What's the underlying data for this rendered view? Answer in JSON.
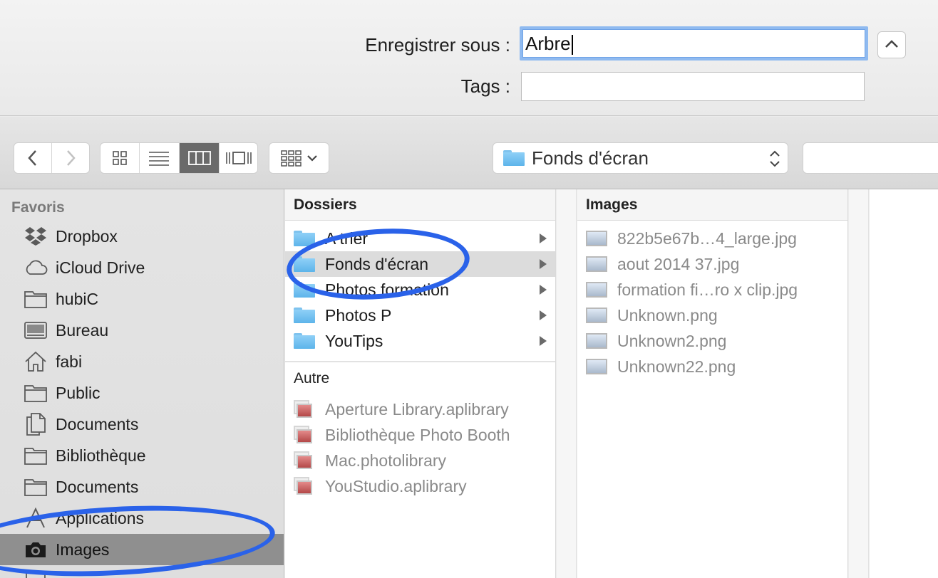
{
  "save_panel": {
    "save_as_label": "Enregistrer sous :",
    "save_as_value": "Arbre",
    "tags_label": "Tags :",
    "tags_value": ""
  },
  "toolbar": {
    "view_buttons": [
      "icon-view",
      "list-view",
      "column-view",
      "cover-flow-view"
    ],
    "active_view": "column-view",
    "path_popup_label": "Fonds d'écran"
  },
  "sidebar": {
    "heading": "Favoris",
    "items": [
      {
        "label": "Dropbox",
        "icon": "dropbox-icon"
      },
      {
        "label": "iCloud Drive",
        "icon": "cloud-icon"
      },
      {
        "label": "hubiC",
        "icon": "folder-icon"
      },
      {
        "label": "Bureau",
        "icon": "desktop-icon"
      },
      {
        "label": "fabi",
        "icon": "home-icon"
      },
      {
        "label": "Public",
        "icon": "folder-icon"
      },
      {
        "label": "Documents",
        "icon": "documents-icon"
      },
      {
        "label": "Bibliothèque",
        "icon": "folder-icon"
      },
      {
        "label": "Documents",
        "icon": "folder-icon"
      },
      {
        "label": "Applications",
        "icon": "applications-icon"
      },
      {
        "label": "Images",
        "icon": "camera-icon",
        "selected": true
      }
    ]
  },
  "column1": {
    "heading": "Dossiers",
    "folders": [
      {
        "label": "A trier"
      },
      {
        "label": "Fonds d'écran",
        "selected": true
      },
      {
        "label": "Photos formation"
      },
      {
        "label": "Photos P"
      },
      {
        "label": "YouTips"
      }
    ],
    "other_heading": "Autre",
    "other_items": [
      {
        "label": "Aperture Library.aplibrary"
      },
      {
        "label": "Bibliothèque Photo Booth"
      },
      {
        "label": "Mac.photolibrary"
      },
      {
        "label": "YouStudio.aplibrary"
      }
    ]
  },
  "column2": {
    "heading": "Images",
    "files": [
      {
        "label": "822b5e67b…4_large.jpg"
      },
      {
        "label": "aout 2014 37.jpg"
      },
      {
        "label": "formation fi…ro x clip.jpg"
      },
      {
        "label": "Unknown.png"
      },
      {
        "label": "Unknown2.png"
      },
      {
        "label": "Unknown22.png"
      }
    ]
  },
  "colors": {
    "annotation": "#2a62e9",
    "folder": "#6bbcf0",
    "selected_sidebar": "#8f8f8f",
    "focus_ring": "#8fbaf0"
  }
}
